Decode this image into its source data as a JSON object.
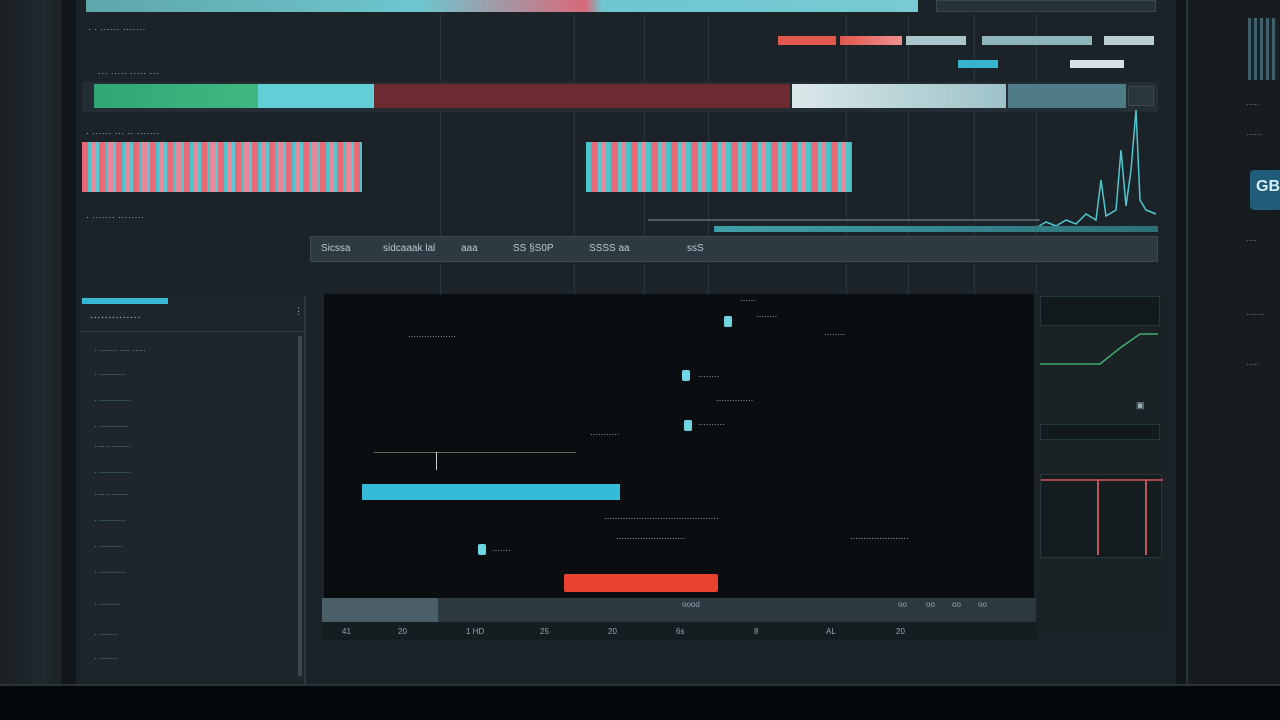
{
  "rows": {
    "row1_label": "· · ······ ·······",
    "row2_label": "··· ····· ····· ···",
    "row3_label": "· ······ ··· ·· ·······",
    "row4_label": "· ······· ········"
  },
  "toolbar": {
    "items": [
      "Sicssa",
      "sidcaaak  lal",
      "aaa",
      "SS §S0P",
      "SSSS  aa",
      "ssS"
    ]
  },
  "tree": {
    "title": "··············",
    "items": [
      "· ······· ···· ·····",
      "· ··········",
      "· ············",
      "· ···········",
      "······ ·······",
      "· ············",
      "······ ······",
      "· ··········",
      "· ·········",
      "· ··········",
      "· ········",
      "· ·······",
      "· ·······"
    ]
  },
  "canvas": {
    "texts": [
      "······",
      "··················",
      "········",
      "··············",
      "···········",
      "··········",
      "···········································",
      "··························",
      "······················",
      "·······"
    ]
  },
  "timeline": {
    "ticks": [
      "41",
      "20",
      "1 HD",
      "25",
      "20",
      "6s",
      "8",
      "AL",
      "20"
    ],
    "controls": [
      "oo",
      "oo",
      "oo",
      "oo",
      "oood"
    ]
  },
  "right_panel": {
    "badge": "GB",
    "items": [
      "·····",
      "······",
      "····",
      "·······",
      "·····"
    ]
  },
  "colors": {
    "accent_cyan": "#3ac3d6",
    "accent_red": "#e8432f",
    "track_red": "#6e2c33",
    "track_green": "#2f9a6b"
  }
}
